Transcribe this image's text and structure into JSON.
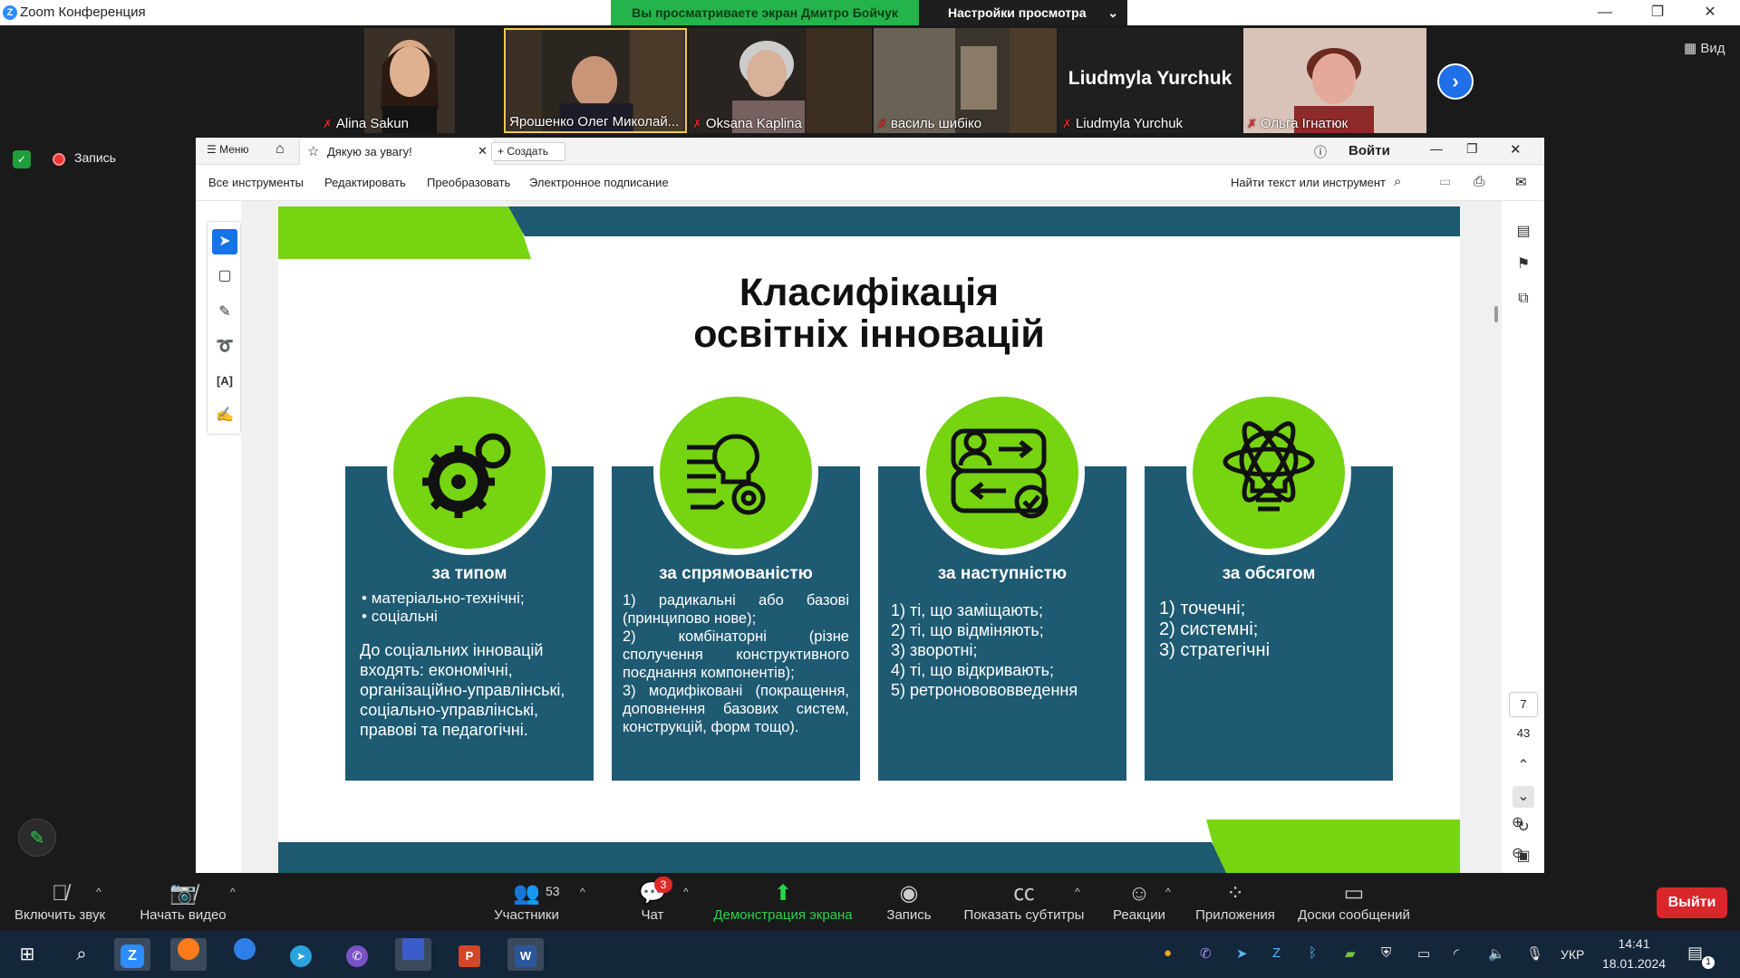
{
  "window": {
    "title": "Zoom Конференция",
    "minimize": "—",
    "restore": "❐",
    "close": "✕"
  },
  "share_banner": {
    "text": "Вы просматриваете экран Дмитро Бойчук",
    "settings": "Настройки просмотра"
  },
  "participants": [
    {
      "name": "Alina Sakun",
      "muted": true
    },
    {
      "name": "Ярошенко Олег Миколай...",
      "muted": false
    },
    {
      "name": "Oksana Kaplina",
      "muted": true
    },
    {
      "name": "василь шибіко",
      "muted": true
    },
    {
      "name": "Liudmyla Yurchuk",
      "muted": true,
      "big_label": "Liudmyla Yurchuk"
    },
    {
      "name": "Ольга Ігнатюк",
      "muted": true
    }
  ],
  "view_button": "Вид",
  "record_label": "Запись",
  "acrobat": {
    "menu": "Меню",
    "tab_title": "Дякую за увагу!",
    "create": "Создать",
    "signin": "Войти",
    "tools": [
      "Все инструменты",
      "Редактировать",
      "Преобразовать",
      "Электронное подписание"
    ],
    "find": "Найти текст или инструмент",
    "page_current": "7",
    "page_total": "43"
  },
  "slide": {
    "title_line1": "Класифікація",
    "title_line2": "освітніх інновацій",
    "cards": [
      {
        "heading": "за типом",
        "bullets": [
          "матеріально-технічні;",
          "соціальні"
        ],
        "text": "До соціальних інновацій входять: економічні, організаційно-управлінські, соціально-управлінські, правові та педагогічні."
      },
      {
        "heading": "за спрямованістю",
        "lines": [
          "1) радикальні або базові (принципово нове);",
          "2) комбінаторні (різне сполучення конструктивного поєднання компонентів);",
          "3) модифіковані (покращення, доповнення базових систем, конструкцій, форм тощо)."
        ]
      },
      {
        "heading": "за наступністю",
        "lines": [
          "1) ті, що заміщають;",
          "2) ті, що відміняють;",
          "3) зворотні;",
          "4) ті, що відкривають;",
          "5) ретроновововведення"
        ]
      },
      {
        "heading": "за обсягом",
        "lines": [
          "1) точечні;",
          "2) системні;",
          "3) стратегічні"
        ]
      }
    ]
  },
  "toolbar": {
    "audio": "Включить звук",
    "video": "Начать видео",
    "participants": "Участники",
    "participants_count": "53",
    "chat": "Чат",
    "chat_badge": "3",
    "share": "Демонстрация экрана",
    "record": "Запись",
    "captions": "Показать субтитры",
    "reactions": "Реакции",
    "apps": "Приложения",
    "whiteboards": "Доски сообщений",
    "leave": "Выйти"
  },
  "taskbar": {
    "lang": "УКР",
    "time": "14:41",
    "date": "18.01.2024",
    "notif_count": "1"
  },
  "colors": {
    "slide_green": "#77d411",
    "slide_teal": "#1e5a72",
    "zoom_blue": "#2d8cff",
    "share_green": "#25b34b",
    "leave_red": "#d9262b"
  }
}
